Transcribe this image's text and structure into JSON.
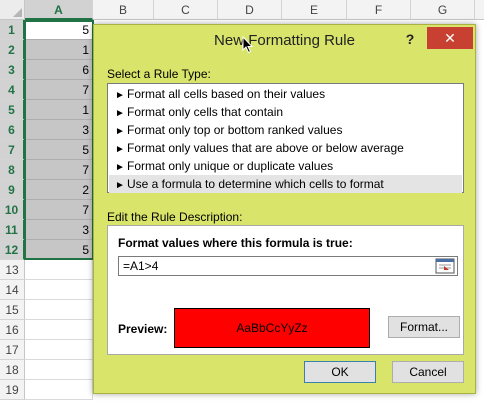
{
  "sheet": {
    "columns": [
      "A",
      "B",
      "C",
      "D",
      "E",
      "F",
      "G"
    ],
    "rows": [
      "1",
      "2",
      "3",
      "4",
      "5",
      "6",
      "7",
      "8",
      "9",
      "10",
      "11",
      "12",
      "13",
      "14",
      "15",
      "16",
      "17",
      "18",
      "19"
    ],
    "column_a_values": [
      "5",
      "1",
      "6",
      "7",
      "1",
      "3",
      "5",
      "7",
      "2",
      "7",
      "3",
      "5"
    ],
    "colors": {
      "selection_green": "#217346",
      "selected_fill": "#c6c6c6"
    }
  },
  "dialog": {
    "title": "New Formatting Rule",
    "help_label": "?",
    "close_label": "✕",
    "select_rule_type_label": "Select a Rule Type:",
    "rule_types": [
      "Format all cells based on their values",
      "Format only cells that contain",
      "Format only top or bottom ranked values",
      "Format only values that are above or below average",
      "Format only unique or duplicate values",
      "Use a formula to determine which cells to format"
    ],
    "edit_description_label": "Edit the Rule Description:",
    "formula_heading": "Format values where this formula is true:",
    "formula_value": "=A1>4",
    "preview_label": "Preview:",
    "preview_sample": "AaBbCcYyZz",
    "format_button": "Format...",
    "ok_button": "OK",
    "cancel_button": "Cancel",
    "colors": {
      "dialog_bg": "#d9e46b",
      "close_bg": "#c84031",
      "preview_fill": "#ff0000"
    }
  }
}
